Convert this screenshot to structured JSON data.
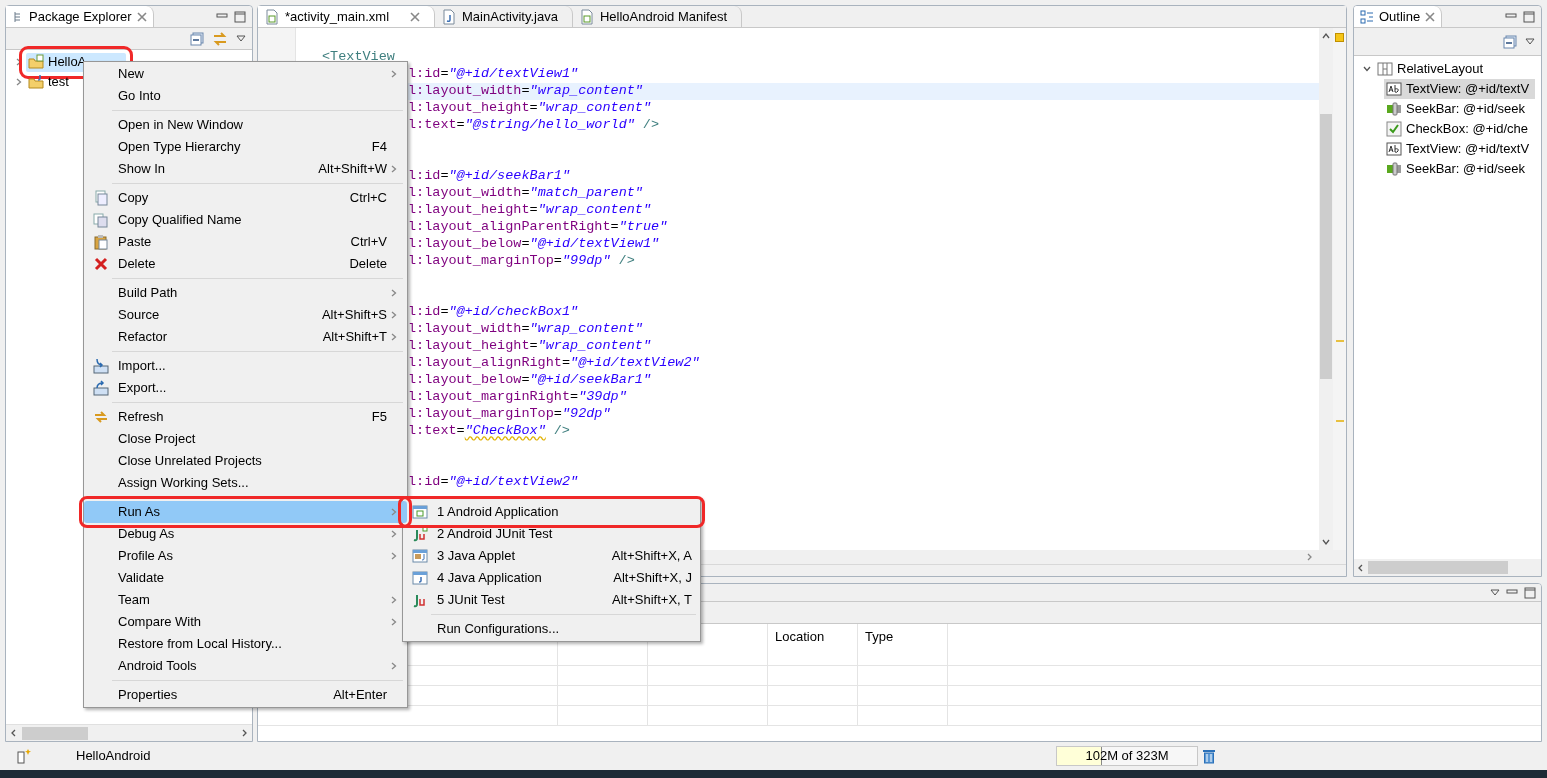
{
  "package_explorer": {
    "title": "Package Explorer",
    "tree": [
      {
        "label": "HelloA",
        "kind": "android-project",
        "expanded": false,
        "selected": true,
        "highlighted": true
      },
      {
        "label": "test",
        "kind": "java-project",
        "expanded": false,
        "selected": false,
        "highlighted": false
      }
    ]
  },
  "editor": {
    "tabs": [
      {
        "label": "*activity_main.xml",
        "kind": "xml",
        "selected": true
      },
      {
        "label": "MainActivity.java",
        "kind": "java",
        "selected": false
      },
      {
        "label": "HelloAndroid Manifest",
        "kind": "xml",
        "selected": false
      }
    ],
    "code_blocks": [
      {
        "lines": [
          {
            "kind": "tag",
            "text": "<TextView",
            "current": false
          },
          {
            "kind": "attr",
            "text": "l:id=\"@+id/textView1\"",
            "current": false
          },
          {
            "kind": "attr",
            "text": "l:layout_width=\"wrap_content\"",
            "current": true
          },
          {
            "kind": "attr",
            "text": "l:layout_height=\"wrap_content\"",
            "current": false
          },
          {
            "kind": "attr",
            "text": "l:text=\"@string/hello_world\"",
            "close": "/>",
            "current": false
          }
        ]
      },
      {
        "lines": [
          {
            "kind": "attr",
            "text": "l:id=\"@+id/seekBar1\"",
            "current": false
          },
          {
            "kind": "attr",
            "text": "l:layout_width=\"match_parent\"",
            "current": false
          },
          {
            "kind": "attr",
            "text": "l:layout_height=\"wrap_content\"",
            "current": false
          },
          {
            "kind": "attr",
            "text": "l:layout_alignParentRight=\"true\"",
            "current": false
          },
          {
            "kind": "attr",
            "text": "l:layout_below=\"@+id/textView1\"",
            "current": false
          },
          {
            "kind": "attr",
            "text": "l:layout_marginTop=\"99dp\"",
            "close": "/>",
            "current": false
          }
        ]
      },
      {
        "lines": [
          {
            "kind": "attr",
            "text": "l:id=\"@+id/checkBox1\"",
            "current": false
          },
          {
            "kind": "attr",
            "text": "l:layout_width=\"wrap_content\"",
            "current": false
          },
          {
            "kind": "attr",
            "text": "l:layout_height=\"wrap_content\"",
            "current": false
          },
          {
            "kind": "attr",
            "text": "l:layout_alignRight=\"@+id/textView2\"",
            "current": false
          },
          {
            "kind": "attr",
            "text": "l:layout_below=\"@+id/seekBar1\"",
            "current": false
          },
          {
            "kind": "attr",
            "text": "l:layout_marginRight=\"39dp\"",
            "current": false
          },
          {
            "kind": "attr",
            "text": "l:layout_marginTop=\"92dp\"",
            "current": false
          },
          {
            "kind": "attr",
            "text": "l:text=\"CheckBox\"",
            "close": "/>",
            "current": false,
            "warning": true
          }
        ]
      },
      {
        "lines": [
          {
            "kind": "attr",
            "text": "l:id=\"@+id/textView2\"",
            "current": false
          }
        ]
      }
    ]
  },
  "outline": {
    "title": "Outline",
    "tree": [
      {
        "label": "RelativeLayout",
        "kind": "layout",
        "expanded": true,
        "selected": false,
        "children": [
          {
            "label": "TextView: @+id/textV",
            "kind": "text",
            "selected": true
          },
          {
            "label": "SeekBar: @+id/seek",
            "kind": "seekbar",
            "selected": false
          },
          {
            "label": "CheckBox: @+id/che",
            "kind": "checkbox",
            "selected": false
          },
          {
            "label": "TextView: @+id/textV",
            "kind": "text",
            "selected": false
          },
          {
            "label": "SeekBar: @+id/seek",
            "kind": "seekbar",
            "selected": false
          }
        ]
      }
    ]
  },
  "bottom_panel": {
    "table": {
      "columns": [
        "Location",
        "Type"
      ]
    }
  },
  "context_menu": {
    "items": [
      {
        "kind": "item",
        "label": "New",
        "submenu": true,
        "selected": false,
        "highlighted": false
      },
      {
        "kind": "item",
        "label": "Go Into",
        "submenu": false,
        "selected": false,
        "highlighted": false
      },
      {
        "kind": "separator"
      },
      {
        "kind": "item",
        "label": "Open in New Window",
        "submenu": false,
        "selected": false,
        "highlighted": false
      },
      {
        "kind": "item",
        "label": "Open Type Hierarchy",
        "shortcut": "F4",
        "submenu": false,
        "selected": false,
        "highlighted": false
      },
      {
        "kind": "item",
        "label": "Show In",
        "shortcut": "Alt+Shift+W",
        "submenu": true,
        "selected": false,
        "highlighted": false
      },
      {
        "kind": "separator"
      },
      {
        "kind": "copy",
        "label": "Copy",
        "shortcut": "Ctrl+C",
        "submenu": false,
        "selected": false,
        "highlighted": false
      },
      {
        "kind": "copy-name",
        "label": "Copy Qualified Name",
        "submenu": false,
        "selected": false,
        "highlighted": false
      },
      {
        "kind": "paste",
        "label": "Paste",
        "shortcut": "Ctrl+V",
        "submenu": false,
        "selected": false,
        "highlighted": false
      },
      {
        "kind": "delete",
        "label": "Delete",
        "shortcut": "Delete",
        "submenu": false,
        "selected": false,
        "highlighted": false
      },
      {
        "kind": "separator"
      },
      {
        "kind": "item",
        "label": "Build Path",
        "submenu": true,
        "selected": false,
        "highlighted": false
      },
      {
        "kind": "item",
        "label": "Source",
        "shortcut": "Alt+Shift+S",
        "submenu": true,
        "selected": false,
        "highlighted": false
      },
      {
        "kind": "item",
        "label": "Refactor",
        "shortcut": "Alt+Shift+T",
        "submenu": true,
        "selected": false,
        "highlighted": false
      },
      {
        "kind": "separator"
      },
      {
        "kind": "import",
        "label": "Import...",
        "submenu": false,
        "selected": false,
        "highlighted": false
      },
      {
        "kind": "export",
        "label": "Export...",
        "submenu": false,
        "selected": false,
        "highlighted": false
      },
      {
        "kind": "separator"
      },
      {
        "kind": "refresh",
        "label": "Refresh",
        "shortcut": "F5",
        "submenu": false,
        "selected": false,
        "highlighted": false
      },
      {
        "kind": "item",
        "label": "Close Project",
        "submenu": false,
        "selected": false,
        "highlighted": false
      },
      {
        "kind": "item",
        "label": "Close Unrelated Projects",
        "submenu": false,
        "selected": false,
        "highlighted": false
      },
      {
        "kind": "item",
        "label": "Assign Working Sets...",
        "submenu": false,
        "selected": false,
        "highlighted": false
      },
      {
        "kind": "separator"
      },
      {
        "kind": "item",
        "label": "Run As",
        "submenu": true,
        "selected": true,
        "highlighted": true
      },
      {
        "kind": "item",
        "label": "Debug As",
        "submenu": true,
        "selected": false,
        "highlighted": false
      },
      {
        "kind": "item",
        "label": "Profile As",
        "submenu": true,
        "selected": false,
        "highlighted": false
      },
      {
        "kind": "item",
        "label": "Validate",
        "submenu": false,
        "selected": false,
        "highlighted": false
      },
      {
        "kind": "item",
        "label": "Team",
        "submenu": true,
        "selected": false,
        "highlighted": false
      },
      {
        "kind": "item",
        "label": "Compare With",
        "submenu": true,
        "selected": false,
        "highlighted": false
      },
      {
        "kind": "item",
        "label": "Restore from Local History...",
        "submenu": false,
        "selected": false,
        "highlighted": false
      },
      {
        "kind": "item",
        "label": "Android Tools",
        "submenu": true,
        "selected": false,
        "highlighted": false
      },
      {
        "kind": "separator"
      },
      {
        "kind": "item",
        "label": "Properties",
        "shortcut": "Alt+Enter",
        "submenu": false,
        "selected": false,
        "highlighted": false
      }
    ]
  },
  "run_as_menu": {
    "items": [
      {
        "kind": "android-app",
        "label": "1 Android Application",
        "selected": false,
        "highlighted": true
      },
      {
        "kind": "android-junit",
        "label": "2 Android JUnit Test",
        "selected": false,
        "highlighted": false
      },
      {
        "kind": "java-applet",
        "label": "3 Java Applet",
        "shortcut": "Alt+Shift+X, A",
        "selected": false,
        "highlighted": false
      },
      {
        "kind": "java-app",
        "label": "4 Java Application",
        "shortcut": "Alt+Shift+X, J",
        "selected": false,
        "highlighted": false
      },
      {
        "kind": "junit",
        "label": "5 JUnit Test",
        "shortcut": "Alt+Shift+X, T",
        "selected": false,
        "highlighted": false
      },
      {
        "kind": "separator"
      },
      {
        "kind": "item",
        "label": "Run Configurations...",
        "selected": false,
        "highlighted": false
      }
    ]
  },
  "status_bar": {
    "selection": "HelloAndroid",
    "memory": {
      "text": "102M of 323M",
      "level": 0.32
    }
  }
}
